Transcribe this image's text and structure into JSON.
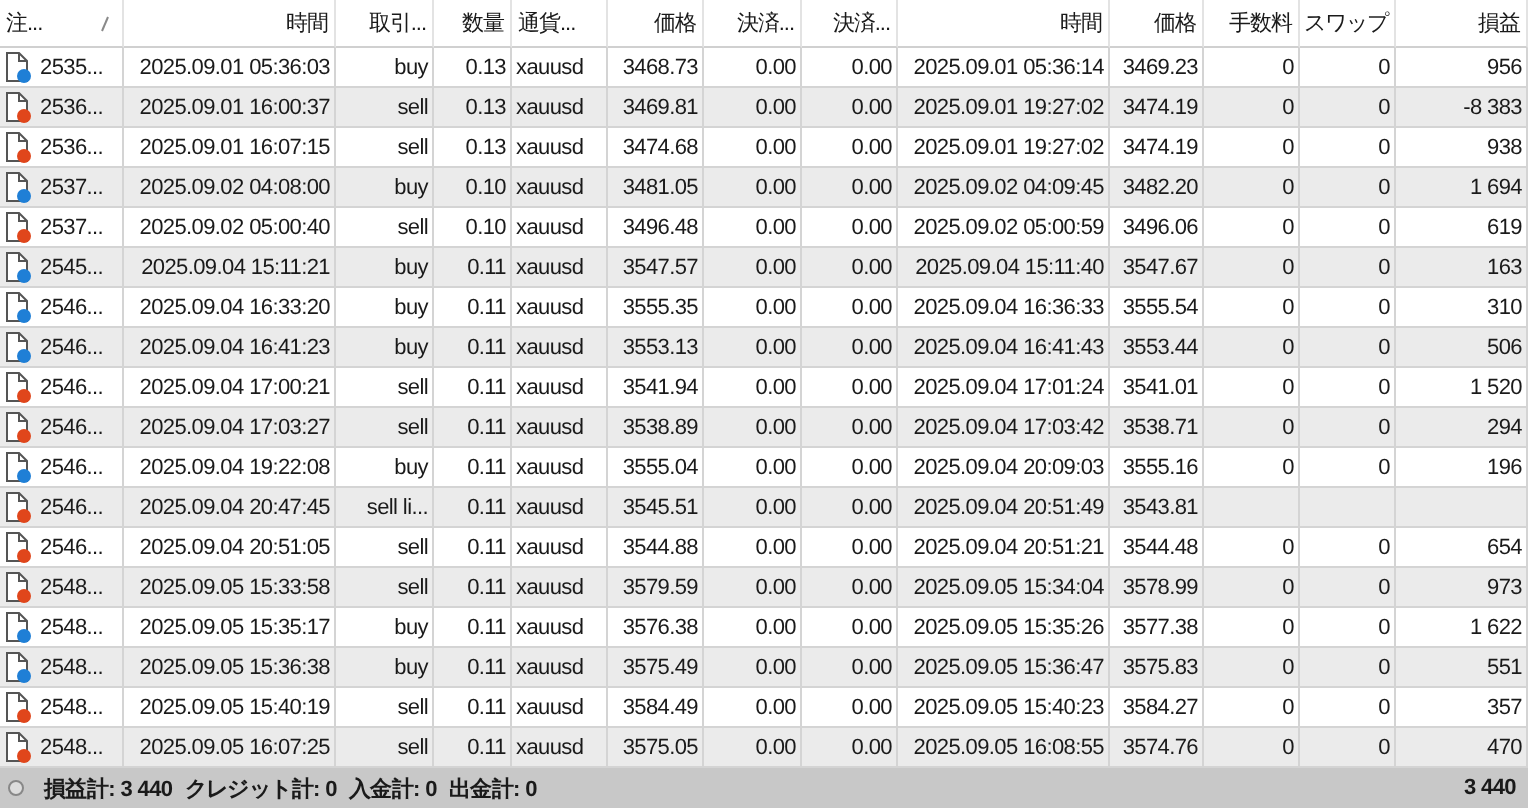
{
  "columns": [
    "注...",
    "時間",
    "取引...",
    "数量",
    "通貨...",
    "価格",
    "決済...",
    "決済...",
    "時間",
    "価格",
    "手数料",
    "スワップ",
    "損益"
  ],
  "rows": [
    {
      "color": "#1f7fd6",
      "cells": [
        "2535...",
        "2025.09.01 05:36:03",
        "buy",
        "0.13",
        "xauusd",
        "3468.73",
        "0.00",
        "0.00",
        "2025.09.01 05:36:14",
        "3469.23",
        "0",
        "0",
        "956"
      ]
    },
    {
      "color": "#e0461b",
      "cells": [
        "2536...",
        "2025.09.01 16:00:37",
        "sell",
        "0.13",
        "xauusd",
        "3469.81",
        "0.00",
        "0.00",
        "2025.09.01 19:27:02",
        "3474.19",
        "0",
        "0",
        "-8 383"
      ]
    },
    {
      "color": "#e0461b",
      "cells": [
        "2536...",
        "2025.09.01 16:07:15",
        "sell",
        "0.13",
        "xauusd",
        "3474.68",
        "0.00",
        "0.00",
        "2025.09.01 19:27:02",
        "3474.19",
        "0",
        "0",
        "938"
      ]
    },
    {
      "color": "#1f7fd6",
      "cells": [
        "2537...",
        "2025.09.02 04:08:00",
        "buy",
        "0.10",
        "xauusd",
        "3481.05",
        "0.00",
        "0.00",
        "2025.09.02 04:09:45",
        "3482.20",
        "0",
        "0",
        "1 694"
      ]
    },
    {
      "color": "#e0461b",
      "cells": [
        "2537...",
        "2025.09.02 05:00:40",
        "sell",
        "0.10",
        "xauusd",
        "3496.48",
        "0.00",
        "0.00",
        "2025.09.02 05:00:59",
        "3496.06",
        "0",
        "0",
        "619"
      ]
    },
    {
      "color": "#1f7fd6",
      "cells": [
        "2545...",
        "2025.09.04 15:11:21",
        "buy",
        "0.11",
        "xauusd",
        "3547.57",
        "0.00",
        "0.00",
        "2025.09.04 15:11:40",
        "3547.67",
        "0",
        "0",
        "163"
      ]
    },
    {
      "color": "#1f7fd6",
      "cells": [
        "2546...",
        "2025.09.04 16:33:20",
        "buy",
        "0.11",
        "xauusd",
        "3555.35",
        "0.00",
        "0.00",
        "2025.09.04 16:36:33",
        "3555.54",
        "0",
        "0",
        "310"
      ]
    },
    {
      "color": "#1f7fd6",
      "cells": [
        "2546...",
        "2025.09.04 16:41:23",
        "buy",
        "0.11",
        "xauusd",
        "3553.13",
        "0.00",
        "0.00",
        "2025.09.04 16:41:43",
        "3553.44",
        "0",
        "0",
        "506"
      ]
    },
    {
      "color": "#e0461b",
      "cells": [
        "2546...",
        "2025.09.04 17:00:21",
        "sell",
        "0.11",
        "xauusd",
        "3541.94",
        "0.00",
        "0.00",
        "2025.09.04 17:01:24",
        "3541.01",
        "0",
        "0",
        "1 520"
      ]
    },
    {
      "color": "#e0461b",
      "cells": [
        "2546...",
        "2025.09.04 17:03:27",
        "sell",
        "0.11",
        "xauusd",
        "3538.89",
        "0.00",
        "0.00",
        "2025.09.04 17:03:42",
        "3538.71",
        "0",
        "0",
        "294"
      ]
    },
    {
      "color": "#1f7fd6",
      "cells": [
        "2546...",
        "2025.09.04 19:22:08",
        "buy",
        "0.11",
        "xauusd",
        "3555.04",
        "0.00",
        "0.00",
        "2025.09.04 20:09:03",
        "3555.16",
        "0",
        "0",
        "196"
      ]
    },
    {
      "color": "#e0461b",
      "cells": [
        "2546...",
        "2025.09.04 20:47:45",
        "sell li...",
        "0.11",
        "xauusd",
        "3545.51",
        "0.00",
        "0.00",
        "2025.09.04 20:51:49",
        "3543.81"
      ]
    },
    {
      "color": "#e0461b",
      "cells": [
        "2546...",
        "2025.09.04 20:51:05",
        "sell",
        "0.11",
        "xauusd",
        "3544.88",
        "0.00",
        "0.00",
        "2025.09.04 20:51:21",
        "3544.48",
        "0",
        "0",
        "654"
      ]
    },
    {
      "color": "#e0461b",
      "cells": [
        "2548...",
        "2025.09.05 15:33:58",
        "sell",
        "0.11",
        "xauusd",
        "3579.59",
        "0.00",
        "0.00",
        "2025.09.05 15:34:04",
        "3578.99",
        "0",
        "0",
        "973"
      ]
    },
    {
      "color": "#1f7fd6",
      "cells": [
        "2548...",
        "2025.09.05 15:35:17",
        "buy",
        "0.11",
        "xauusd",
        "3576.38",
        "0.00",
        "0.00",
        "2025.09.05 15:35:26",
        "3577.38",
        "0",
        "0",
        "1 622"
      ]
    },
    {
      "color": "#1f7fd6",
      "cells": [
        "2548...",
        "2025.09.05 15:36:38",
        "buy",
        "0.11",
        "xauusd",
        "3575.49",
        "0.00",
        "0.00",
        "2025.09.05 15:36:47",
        "3575.83",
        "0",
        "0",
        "551"
      ]
    },
    {
      "color": "#e0461b",
      "cells": [
        "2548...",
        "2025.09.05 15:40:19",
        "sell",
        "0.11",
        "xauusd",
        "3584.49",
        "0.00",
        "0.00",
        "2025.09.05 15:40:23",
        "3584.27",
        "0",
        "0",
        "357"
      ]
    },
    {
      "color": "#e0461b",
      "cells": [
        "2548...",
        "2025.09.05 16:07:25",
        "sell",
        "0.11",
        "xauusd",
        "3575.05",
        "0.00",
        "0.00",
        "2025.09.05 16:08:55",
        "3574.76",
        "0",
        "0",
        "470"
      ]
    }
  ],
  "summary": {
    "items": [
      "損益計: 3 440",
      "クレジット計: 0",
      "入金計: 0",
      "出金計: 0"
    ],
    "total": "3 440"
  }
}
